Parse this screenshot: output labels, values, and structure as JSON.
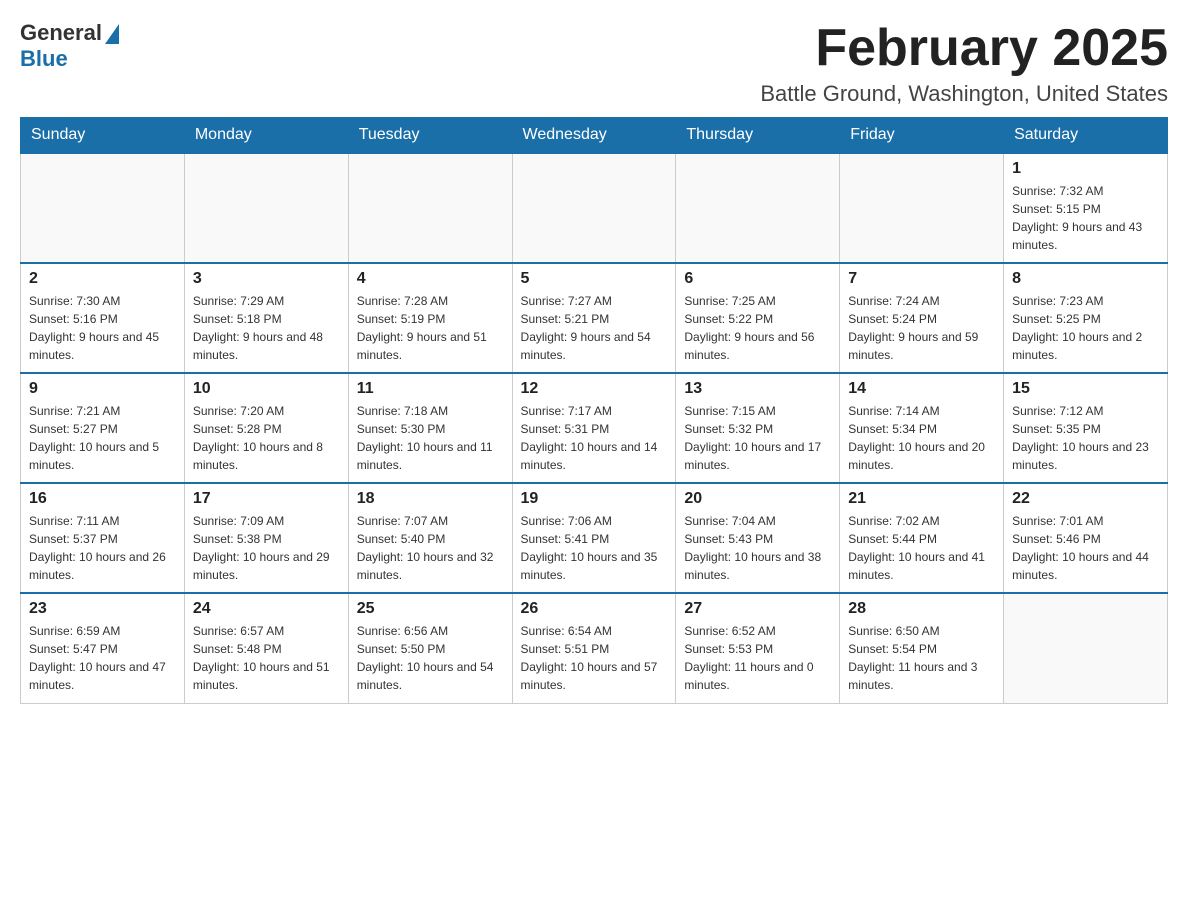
{
  "header": {
    "logo_general": "General",
    "logo_blue": "Blue",
    "month_title": "February 2025",
    "location": "Battle Ground, Washington, United States"
  },
  "days_of_week": [
    "Sunday",
    "Monday",
    "Tuesday",
    "Wednesday",
    "Thursday",
    "Friday",
    "Saturday"
  ],
  "weeks": [
    [
      {
        "day": "",
        "info": ""
      },
      {
        "day": "",
        "info": ""
      },
      {
        "day": "",
        "info": ""
      },
      {
        "day": "",
        "info": ""
      },
      {
        "day": "",
        "info": ""
      },
      {
        "day": "",
        "info": ""
      },
      {
        "day": "1",
        "info": "Sunrise: 7:32 AM\nSunset: 5:15 PM\nDaylight: 9 hours and 43 minutes."
      }
    ],
    [
      {
        "day": "2",
        "info": "Sunrise: 7:30 AM\nSunset: 5:16 PM\nDaylight: 9 hours and 45 minutes."
      },
      {
        "day": "3",
        "info": "Sunrise: 7:29 AM\nSunset: 5:18 PM\nDaylight: 9 hours and 48 minutes."
      },
      {
        "day": "4",
        "info": "Sunrise: 7:28 AM\nSunset: 5:19 PM\nDaylight: 9 hours and 51 minutes."
      },
      {
        "day": "5",
        "info": "Sunrise: 7:27 AM\nSunset: 5:21 PM\nDaylight: 9 hours and 54 minutes."
      },
      {
        "day": "6",
        "info": "Sunrise: 7:25 AM\nSunset: 5:22 PM\nDaylight: 9 hours and 56 minutes."
      },
      {
        "day": "7",
        "info": "Sunrise: 7:24 AM\nSunset: 5:24 PM\nDaylight: 9 hours and 59 minutes."
      },
      {
        "day": "8",
        "info": "Sunrise: 7:23 AM\nSunset: 5:25 PM\nDaylight: 10 hours and 2 minutes."
      }
    ],
    [
      {
        "day": "9",
        "info": "Sunrise: 7:21 AM\nSunset: 5:27 PM\nDaylight: 10 hours and 5 minutes."
      },
      {
        "day": "10",
        "info": "Sunrise: 7:20 AM\nSunset: 5:28 PM\nDaylight: 10 hours and 8 minutes."
      },
      {
        "day": "11",
        "info": "Sunrise: 7:18 AM\nSunset: 5:30 PM\nDaylight: 10 hours and 11 minutes."
      },
      {
        "day": "12",
        "info": "Sunrise: 7:17 AM\nSunset: 5:31 PM\nDaylight: 10 hours and 14 minutes."
      },
      {
        "day": "13",
        "info": "Sunrise: 7:15 AM\nSunset: 5:32 PM\nDaylight: 10 hours and 17 minutes."
      },
      {
        "day": "14",
        "info": "Sunrise: 7:14 AM\nSunset: 5:34 PM\nDaylight: 10 hours and 20 minutes."
      },
      {
        "day": "15",
        "info": "Sunrise: 7:12 AM\nSunset: 5:35 PM\nDaylight: 10 hours and 23 minutes."
      }
    ],
    [
      {
        "day": "16",
        "info": "Sunrise: 7:11 AM\nSunset: 5:37 PM\nDaylight: 10 hours and 26 minutes."
      },
      {
        "day": "17",
        "info": "Sunrise: 7:09 AM\nSunset: 5:38 PM\nDaylight: 10 hours and 29 minutes."
      },
      {
        "day": "18",
        "info": "Sunrise: 7:07 AM\nSunset: 5:40 PM\nDaylight: 10 hours and 32 minutes."
      },
      {
        "day": "19",
        "info": "Sunrise: 7:06 AM\nSunset: 5:41 PM\nDaylight: 10 hours and 35 minutes."
      },
      {
        "day": "20",
        "info": "Sunrise: 7:04 AM\nSunset: 5:43 PM\nDaylight: 10 hours and 38 minutes."
      },
      {
        "day": "21",
        "info": "Sunrise: 7:02 AM\nSunset: 5:44 PM\nDaylight: 10 hours and 41 minutes."
      },
      {
        "day": "22",
        "info": "Sunrise: 7:01 AM\nSunset: 5:46 PM\nDaylight: 10 hours and 44 minutes."
      }
    ],
    [
      {
        "day": "23",
        "info": "Sunrise: 6:59 AM\nSunset: 5:47 PM\nDaylight: 10 hours and 47 minutes."
      },
      {
        "day": "24",
        "info": "Sunrise: 6:57 AM\nSunset: 5:48 PM\nDaylight: 10 hours and 51 minutes."
      },
      {
        "day": "25",
        "info": "Sunrise: 6:56 AM\nSunset: 5:50 PM\nDaylight: 10 hours and 54 minutes."
      },
      {
        "day": "26",
        "info": "Sunrise: 6:54 AM\nSunset: 5:51 PM\nDaylight: 10 hours and 57 minutes."
      },
      {
        "day": "27",
        "info": "Sunrise: 6:52 AM\nSunset: 5:53 PM\nDaylight: 11 hours and 0 minutes."
      },
      {
        "day": "28",
        "info": "Sunrise: 6:50 AM\nSunset: 5:54 PM\nDaylight: 11 hours and 3 minutes."
      },
      {
        "day": "",
        "info": ""
      }
    ]
  ]
}
